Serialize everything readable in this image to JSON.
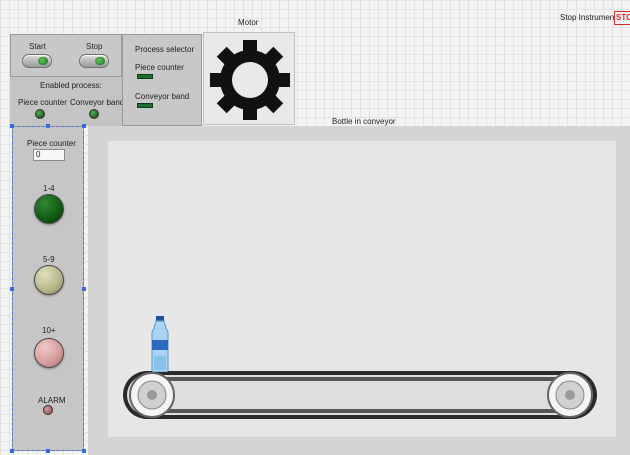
{
  "header": {
    "motor_label": "Motor",
    "stop_instrument_label": "Stop Instrument",
    "stop_button_text": "STOP",
    "bottle_label": "Bottle in conveyor"
  },
  "controls": {
    "start_label": "Start",
    "stop_label": "Stop",
    "enabled_process_title": "Enabled process:",
    "enabled_piece_counter": "Piece counter",
    "enabled_conveyor_band": "Conveyor band"
  },
  "process_selector": {
    "title": "Process selector",
    "option_piece_counter": "Piece counter",
    "option_conveyor_band": "Conveyor band"
  },
  "counter_panel": {
    "title": "Piece counter",
    "value": "0",
    "range1_label": "1-4",
    "range2_label": "5-9",
    "range3_label": "10+",
    "alarm_label": "ALARM"
  },
  "colors": {
    "led_range1": "#0f5a14",
    "led_range2": "#b6b48a",
    "led_range3": "#d49a9a",
    "led_alarm": "#b06a6a",
    "accent_green": "#1f6f2c",
    "stop_red": "#d43030"
  },
  "icons": {
    "motor": "gear-icon",
    "bottle": "water-bottle-icon",
    "conveyor": "conveyor-belt-icon"
  }
}
